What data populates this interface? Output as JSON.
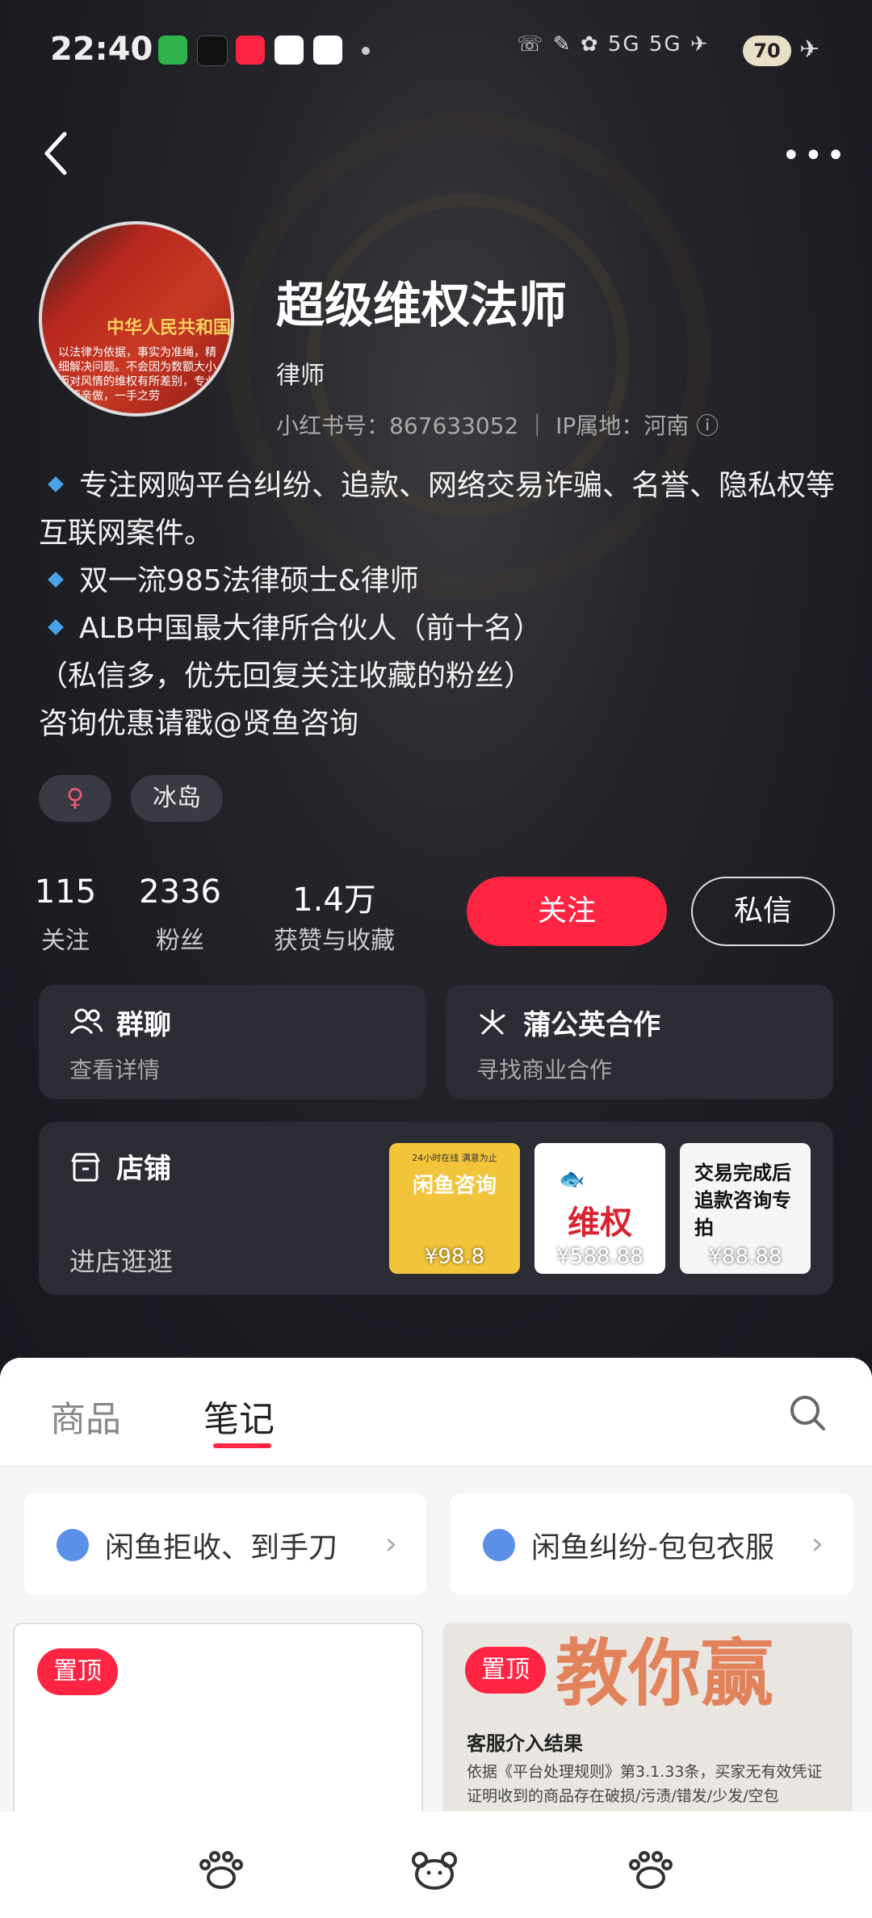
{
  "status_bar": {
    "time": "22:40",
    "right_text": "5G 5G",
    "battery": "70"
  },
  "profile": {
    "name": "超级维权法师",
    "role": "律师",
    "id_line": "小红书号：867633052 ｜ IP属地：河南 ⓘ",
    "avatar_text_1": "中华人民共和国",
    "avatar_text_2": "以法律为依据，事实为准绳，精细解决问题。不会因为数额大小而对风情的维权有所差别，专业律师亲做，一手之劳",
    "bio": [
      "专注网购平台纠纷、追款、网络交易诈骗、名誉、隐私权等互联网案件。",
      "双一流985法律硕士&律师",
      "ALB中国最大律所合伙人（前十名）"
    ],
    "bio_extra": [
      "（私信多，优先回复关注收藏的粉丝）",
      "咨询优惠请戳@贤鱼咨询"
    ],
    "tags": [
      "♀",
      "冰岛"
    ]
  },
  "stats": [
    {
      "num": "115",
      "label": "关注"
    },
    {
      "num": "2336",
      "label": "粉丝"
    },
    {
      "num": "1.4万",
      "label": "获赞与收藏"
    }
  ],
  "buttons": {
    "follow": "关注",
    "message": "私信"
  },
  "cards": {
    "group": {
      "title": "群聊",
      "sub": "查看详情"
    },
    "dandelion": {
      "title": "蒲公英合作",
      "sub": "寻找商业合作"
    },
    "shop": {
      "title": "店铺",
      "sub": "进店逛逛"
    }
  },
  "products": [
    {
      "top": "24小时在线 满意为止",
      "title": "闲鱼咨询",
      "price": "¥98.8",
      "bg": "#f2c43a"
    },
    {
      "title": "维权",
      "price": "¥588.88",
      "bg": "#ffffff"
    },
    {
      "title": "交易完成后追款咨询专拍",
      "price": "¥88.88",
      "bg": "#f5f5f5"
    }
  ],
  "tabs": {
    "goods": "商品",
    "notes": "笔记"
  },
  "collections": [
    {
      "label": "闲鱼拒收、到手刀"
    },
    {
      "label": "闲鱼纠纷-包包衣服"
    }
  ],
  "notes": [
    {
      "pin": "置顶"
    },
    {
      "pin": "置顶",
      "big_text": "教你赢",
      "heading": "客服介入结果",
      "body": "依据《平台处理规则》第3.1.33条，买家无有效凭证证明收到的商品存在破损/污渍/错发/少发/空包"
    }
  ],
  "colors": {
    "accent": "#ff2442",
    "bg": "#1a1b22",
    "diamond": "#4aa3e8"
  }
}
